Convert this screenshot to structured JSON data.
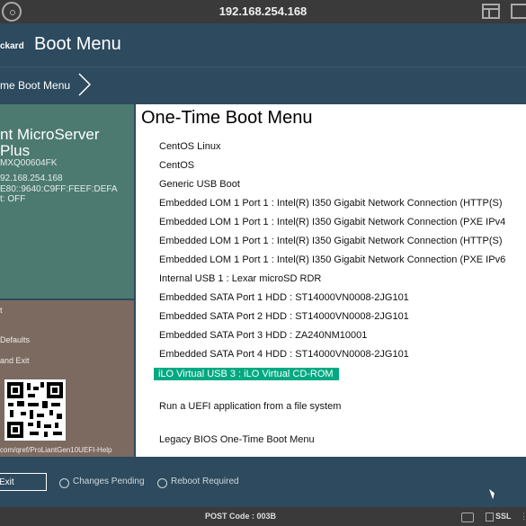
{
  "topbar": {
    "ip": "192.168.254.168"
  },
  "header": {
    "brand": "ckard",
    "title": "Boot Menu"
  },
  "breadcrumb": {
    "label": "me Boot Menu"
  },
  "server": {
    "name_line1": "nt MicroServer",
    "name_line2": "Plus",
    "serial": "MXQ00604FK",
    "ip": "92.168.254.168",
    "ipv6": "E80::9640:C9FF:FEEF:DEFA",
    "status": "t: OFF"
  },
  "sidebar_links": {
    "link1": "t",
    "link2": "Defaults",
    "link3": "and Exit",
    "help_url": "com/qref/ProLiantGen10UEFI-Help"
  },
  "main": {
    "heading": "One-Time Boot Menu",
    "options": [
      "CentOS Linux",
      "CentOS",
      "Generic USB Boot",
      "Embedded LOM 1 Port 1 : Intel(R) I350 Gigabit Network Connection (HTTP(S)",
      "Embedded LOM 1 Port 1 : Intel(R) I350 Gigabit Network Connection (PXE IPv4",
      "Embedded LOM 1 Port 1 : Intel(R) I350 Gigabit Network Connection (HTTP(S)",
      "Embedded LOM 1 Port 1 : Intel(R) I350 Gigabit Network Connection (PXE IPv6",
      "Internal USB 1 : Lexar microSD RDR",
      "Embedded SATA Port 1 HDD : ST14000VN0008-2JG101",
      "Embedded SATA Port 2 HDD : ST14000VN0008-2JG101",
      "Embedded SATA Port 3 HDD : ZA240NM10001",
      "Embedded SATA Port 4 HDD : ST14000VN0008-2JG101",
      "iLO Virtual USB 3 : iLO Virtual CD-ROM"
    ],
    "selected_index": 12,
    "uefi_app": "Run a UEFI application from a file system",
    "legacy": "Legacy BIOS One-Time Boot Menu"
  },
  "footer": {
    "exit_label": "Exit",
    "changes_pending": "Changes Pending",
    "reboot_required": "Reboot Required"
  },
  "statusbar": {
    "post_code": "POST Code : 003B",
    "ssl": "SSL"
  },
  "colors": {
    "header_bg": "#2d4a5e",
    "sidebar_top": "#4c7a70",
    "sidebar_bottom": "#7c6a60",
    "selection": "#01a982"
  }
}
